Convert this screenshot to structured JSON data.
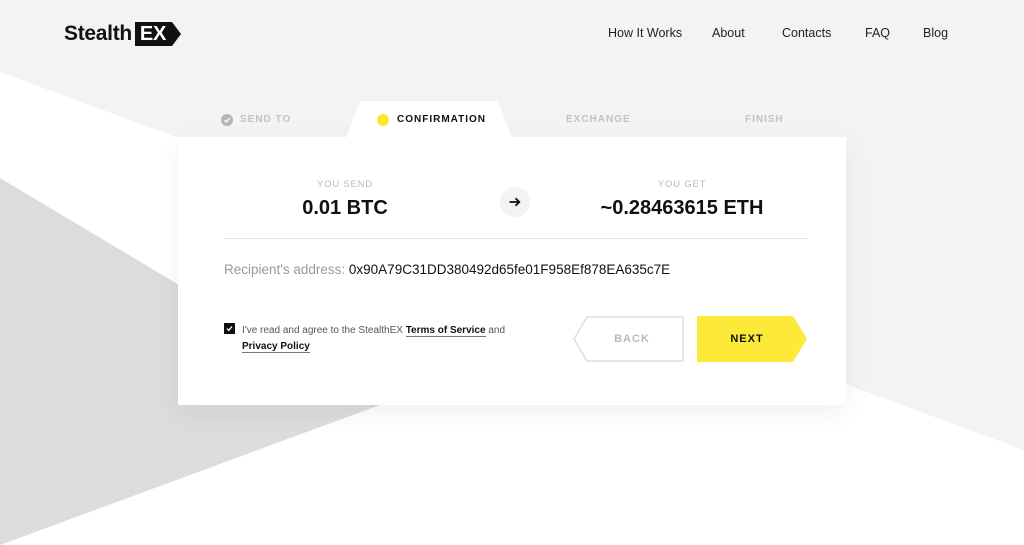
{
  "brand": {
    "name_part1": "Stealth",
    "name_part2": "EX"
  },
  "nav": {
    "items": [
      {
        "label": "How It Works"
      },
      {
        "label": "About"
      },
      {
        "label": "Contacts"
      },
      {
        "label": "FAQ"
      },
      {
        "label": "Blog"
      }
    ]
  },
  "steps": [
    {
      "label": "SEND TO",
      "state": "completed"
    },
    {
      "label": "CONFIRMATION",
      "state": "active"
    },
    {
      "label": "EXCHANGE",
      "state": "pending"
    },
    {
      "label": "FINISH",
      "state": "pending"
    }
  ],
  "exchange": {
    "send_label": "YOU SEND",
    "send_value": "0.01 BTC",
    "get_label": "YOU GET",
    "get_value": "~0.28463615 ETH"
  },
  "recipient": {
    "label": "Recipient's address:",
    "value": "0x90A79C31DD380492d65fe01F958Ef878EA635c7E"
  },
  "agreement": {
    "checked": true,
    "text_before": "I've read and agree to the StealthEX ",
    "terms_link": "Terms of Service",
    "text_and": " and ",
    "privacy_link": "Privacy Policy"
  },
  "buttons": {
    "back_label": "BACK",
    "next_label": "NEXT"
  },
  "colors": {
    "accent_yellow": "#fde937",
    "text_dark": "#111111",
    "muted_gray": "#c3c3c3",
    "bg_light": "#f3f3f3",
    "bg_gray": "#dcdcdc"
  }
}
